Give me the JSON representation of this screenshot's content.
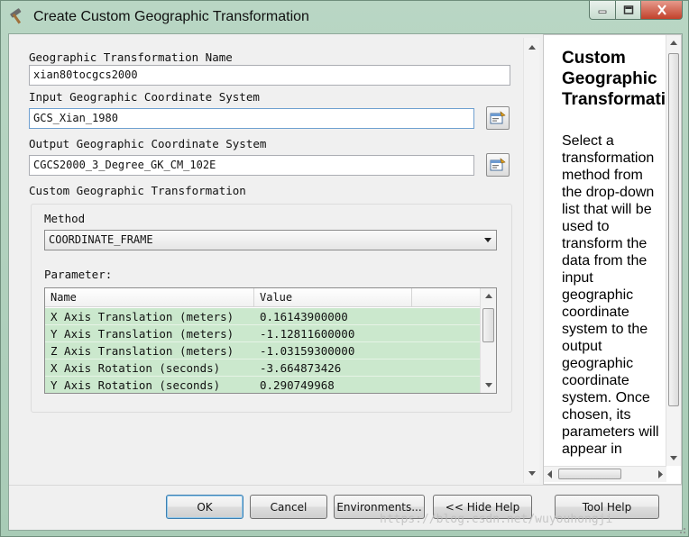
{
  "window": {
    "title": "Create Custom Geographic Transformation"
  },
  "form": {
    "name_label": "Geographic Transformation Name",
    "name_value": "xian80tocgcs2000",
    "input_label": "Input Geographic Coordinate System",
    "input_value": "GCS_Xian_1980",
    "output_label": "Output Geographic Coordinate System",
    "output_value": "CGCS2000_3_Degree_GK_CM_102E",
    "custom_label": "Custom Geographic Transformation",
    "method_label": "Method",
    "method_value": "COORDINATE_FRAME",
    "parameter_label": "Parameter:",
    "grid": {
      "headers": [
        "Name",
        "Value"
      ],
      "rows": [
        {
          "name": "X Axis Translation (meters)",
          "value": "0.16143900000"
        },
        {
          "name": "Y Axis Translation (meters)",
          "value": "-1.12811600000"
        },
        {
          "name": "Z Axis Translation (meters)",
          "value": "-1.03159300000"
        },
        {
          "name": "X Axis Rotation (seconds)",
          "value": "-3.664873426"
        },
        {
          "name": "Y Axis Rotation (seconds)",
          "value": "0.290749968"
        }
      ]
    }
  },
  "help": {
    "title": "Custom\nGeographic\nTransformation",
    "body": "Select a transformation method from the drop-down list that will be used to transform the data from the input geographic coordinate system to the output geographic coordinate system. Once chosen, its parameters will appear in"
  },
  "buttons": {
    "ok": "OK",
    "cancel": "Cancel",
    "environments": "Environments...",
    "hide_help": "<< Hide Help",
    "tool_help": "Tool Help"
  },
  "watermark": "https://blog.csdn.net/wuyouhongji",
  "colors": {
    "row_highlight": "#cbe8cd",
    "window_frame": "#b9d6c4",
    "close_button": "#c2412b"
  }
}
